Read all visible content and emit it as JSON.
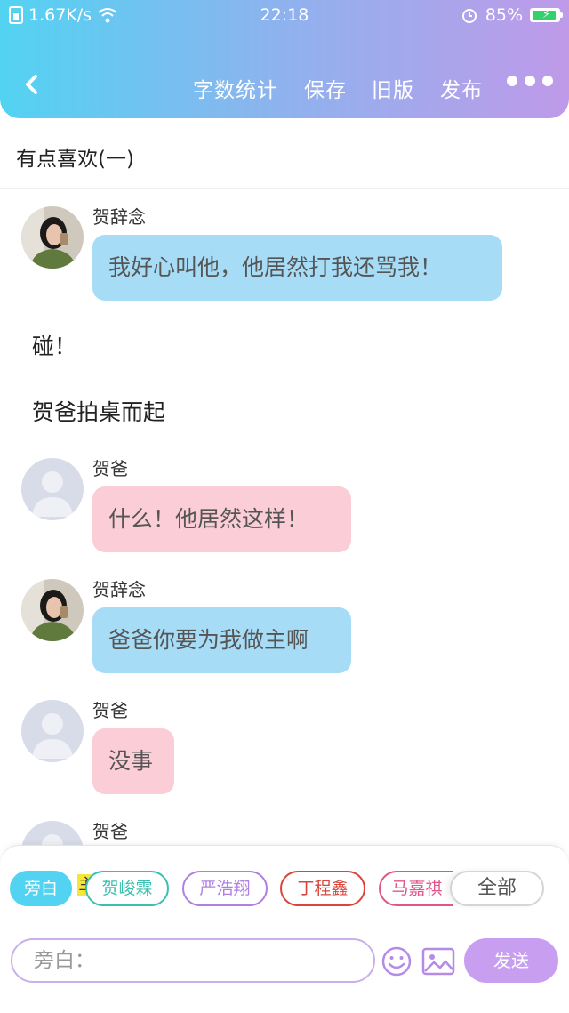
{
  "status_bar": {
    "speed": "1.67K/s",
    "time": "22:18",
    "battery": "85%"
  },
  "nav": {
    "word_count": "字数统计",
    "save": "保存",
    "old_version": "旧版",
    "publish": "发布"
  },
  "story_title": "有点喜欢(一)",
  "messages": [
    {
      "speaker": "贺辞念",
      "text": "我好心叫他，他居然打我还骂我！"
    },
    {
      "narration": "碰！"
    },
    {
      "narration": "贺爸拍桌而起"
    },
    {
      "speaker": "贺爸",
      "text": "什么！他居然这样！"
    },
    {
      "speaker": "贺辞念",
      "text": "爸爸你要为我做主啊"
    },
    {
      "speaker": "贺爸",
      "text": "没事"
    },
    {
      "speaker": "贺爸"
    }
  ],
  "characters": {
    "narrator": "旁白",
    "main_tag": "主",
    "items": [
      "贺峻霖",
      "严浩翔",
      "丁程鑫",
      "马嘉祺"
    ],
    "all": "全部"
  },
  "input": {
    "placeholder": "旁白：",
    "send": "发送"
  },
  "colors": {
    "accent_start": "#52d3f2",
    "accent_end": "#bf9ae9",
    "bubble_blue": "#a7dcf7",
    "bubble_pink": "#fbcdd6"
  }
}
